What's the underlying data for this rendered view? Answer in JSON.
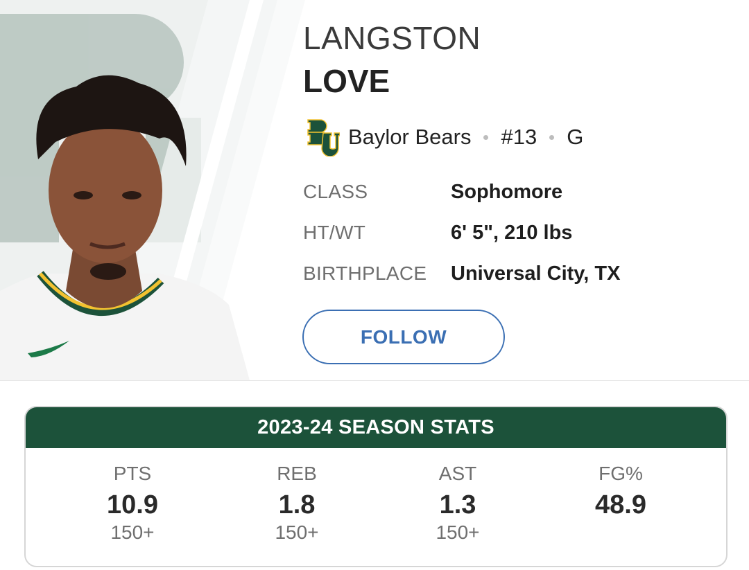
{
  "player": {
    "first_name": "LANGSTON",
    "last_name": "LOVE",
    "team": "Baylor Bears",
    "number": "#13",
    "position": "G"
  },
  "info": [
    {
      "label": "CLASS",
      "value": "Sophomore"
    },
    {
      "label": "HT/WT",
      "value": "6' 5\", 210 lbs"
    },
    {
      "label": "BIRTHPLACE",
      "value": "Universal City, TX"
    }
  ],
  "follow_label": "FOLLOW",
  "stats": {
    "title": "2023-24 SEASON STATS",
    "items": [
      {
        "label": "PTS",
        "value": "10.9",
        "rank": "150+"
      },
      {
        "label": "REB",
        "value": "1.8",
        "rank": "150+"
      },
      {
        "label": "AST",
        "value": "1.3",
        "rank": "150+"
      },
      {
        "label": "FG%",
        "value": "48.9",
        "rank": ""
      }
    ]
  },
  "colors": {
    "team_green": "#1c523a",
    "team_gold": "#f2c230",
    "accent_blue": "#3b6fb3"
  },
  "icons": {
    "team_logo": "baylor-bu-logo"
  }
}
